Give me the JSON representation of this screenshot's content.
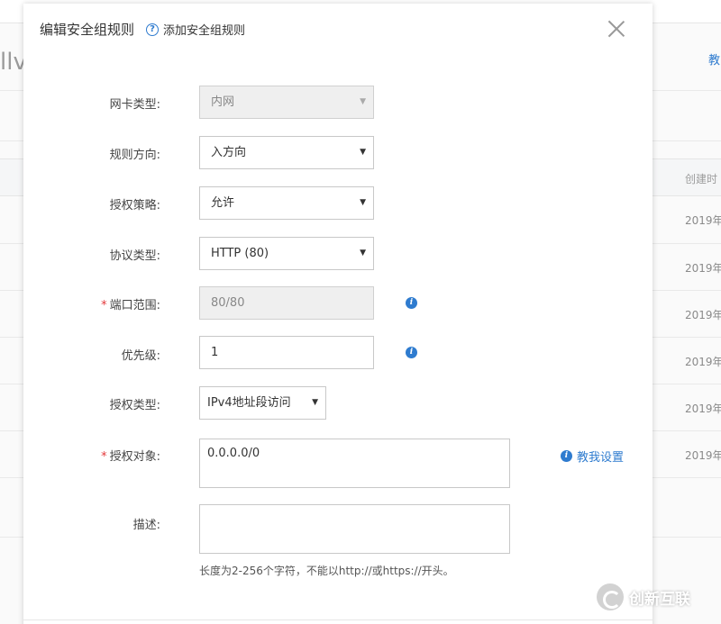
{
  "background": {
    "title_fragment": "llv",
    "right_link": "教",
    "column_header": "创建时",
    "rows": [
      "2019年",
      "2019年",
      "2019年",
      "2019年",
      "2019年",
      "2019年"
    ]
  },
  "dialog": {
    "title": "编辑安全组规则",
    "help_link": "添加安全组规则"
  },
  "form": {
    "nic_type": {
      "label": "网卡类型:",
      "value": "内网"
    },
    "direction": {
      "label": "规则方向:",
      "value": "入方向"
    },
    "policy": {
      "label": "授权策略:",
      "value": "允许"
    },
    "protocol": {
      "label": "协议类型:",
      "value": "HTTP (80)"
    },
    "port_range": {
      "label": "端口范围:",
      "value": "80/80",
      "required": "*"
    },
    "priority": {
      "label": "优先级:",
      "value": "1"
    },
    "auth_type": {
      "label": "授权类型:",
      "value": "IPv4地址段访问"
    },
    "auth_object": {
      "label": "授权对象:",
      "value": "0.0.0.0/0",
      "required": "*",
      "teach_link": "教我设置"
    },
    "description": {
      "label": "描述:",
      "value": "",
      "hint": "长度为2-256个字符，不能以http://或https://开头。"
    }
  },
  "watermark": {
    "text": "创新互联"
  },
  "icons": {
    "help": "question-circle-icon",
    "info": "info-circle-icon",
    "close": "close-icon",
    "caret": "caret-down-icon"
  },
  "colors": {
    "link": "#2e7bcf",
    "required": "#e4393c",
    "disabled_bg": "#efefef"
  }
}
